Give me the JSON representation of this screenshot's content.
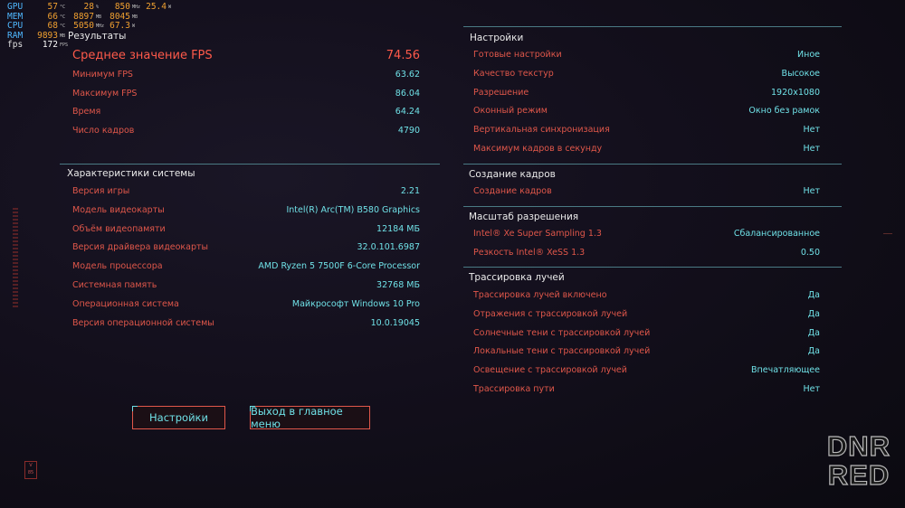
{
  "overlay": {
    "rows": [
      {
        "label": "GPU",
        "v1": "57",
        "u1": "°C",
        "v2": "28",
        "u2": "%",
        "v3": "850",
        "u3": "MHz",
        "v4": "25.4",
        "u4": "W"
      },
      {
        "label": "MEM",
        "v1": "66",
        "u1": "°C",
        "v2": "8897",
        "u2": "MB",
        "v3": "8045",
        "u3": "MB",
        "v4": "",
        "u4": ""
      },
      {
        "label": "CPU",
        "v1": "68",
        "u1": "°C",
        "v2": "5050",
        "u2": "MHz",
        "v3": "67.3",
        "u3": "W",
        "v4": "",
        "u4": ""
      },
      {
        "label": "RAM",
        "v1": "9893",
        "u1": "MB",
        "v2": "",
        "u2": "",
        "v3": "",
        "u3": "",
        "v4": "",
        "u4": ""
      },
      {
        "label": "fps",
        "v1": "172",
        "u1": "FPS",
        "v2": "",
        "u2": "",
        "v3": "",
        "u3": "",
        "v4": "",
        "u4": ""
      }
    ]
  },
  "results": {
    "title": "Результаты",
    "avg_fps": {
      "label": "Среднее значение FPS",
      "value": "74.56"
    },
    "rows": [
      {
        "label": "Минимум FPS",
        "value": "63.62"
      },
      {
        "label": "Максимум FPS",
        "value": "86.04"
      },
      {
        "label": "Время",
        "value": "64.24"
      },
      {
        "label": "Число кадров",
        "value": "4790"
      }
    ]
  },
  "system": {
    "title": "Характеристики системы",
    "rows": [
      {
        "label": "Версия игры",
        "value": "2.21"
      },
      {
        "label": "Модель видеокарты",
        "value": "Intel(R) Arc(TM) B580 Graphics"
      },
      {
        "label": "Объём видеопамяти",
        "value": "12184 МБ"
      },
      {
        "label": "Версия драйвера видеокарты",
        "value": "32.0.101.6987"
      },
      {
        "label": "Модель процессора",
        "value": "AMD Ryzen 5 7500F 6-Core Processor"
      },
      {
        "label": "Системная память",
        "value": "32768 МБ"
      },
      {
        "label": "Операционная система",
        "value": "Майкрософт Windows 10 Pro"
      },
      {
        "label": "Версия операционной системы",
        "value": "10.0.19045"
      }
    ]
  },
  "settings": {
    "title": "Настройки",
    "rows": [
      {
        "label": "Готовые настройки",
        "value": "Иное"
      },
      {
        "label": "Качество текстур",
        "value": "Высокое"
      },
      {
        "label": "Разрешение",
        "value": "1920x1080"
      },
      {
        "label": "Оконный режим",
        "value": "Окно без рамок"
      },
      {
        "label": "Вертикальная синхронизация",
        "value": "Нет"
      },
      {
        "label": "Максимум кадров в секунду",
        "value": "Нет"
      }
    ]
  },
  "frame_gen": {
    "title": "Создание кадров",
    "rows": [
      {
        "label": "Создание кадров",
        "value": "Нет"
      }
    ]
  },
  "scaling": {
    "title": "Масштаб разрешения",
    "rows": [
      {
        "label": "Intel® Xe Super Sampling 1.3",
        "value": "Сбалансированное"
      },
      {
        "label": "Резкость Intel® XeSS 1.3",
        "value": "0.50"
      }
    ]
  },
  "raytracing": {
    "title": "Трассировка лучей",
    "rows": [
      {
        "label": "Трассировка лучей включено",
        "value": "Да"
      },
      {
        "label": "Отражения с трассировкой лучей",
        "value": "Да"
      },
      {
        "label": "Солнечные тени с трассировкой лучей",
        "value": "Да"
      },
      {
        "label": "Локальные тени с трассировкой лучей",
        "value": "Да"
      },
      {
        "label": "Освещение с трассировкой лучей",
        "value": "Впечатляющее"
      },
      {
        "label": "Трассировка пути",
        "value": "Нет"
      }
    ]
  },
  "buttons": {
    "settings": "Настройки",
    "main_menu": "Выход в главное меню"
  },
  "watermark": {
    "line1": "DNR",
    "line2": "RED"
  },
  "badge": {
    "line1": "V",
    "line2": "85"
  },
  "colors": {
    "label": "#e0574a",
    "value": "#6fe0e6",
    "accent": "#ff5a4a",
    "line": "#4a7a84"
  }
}
